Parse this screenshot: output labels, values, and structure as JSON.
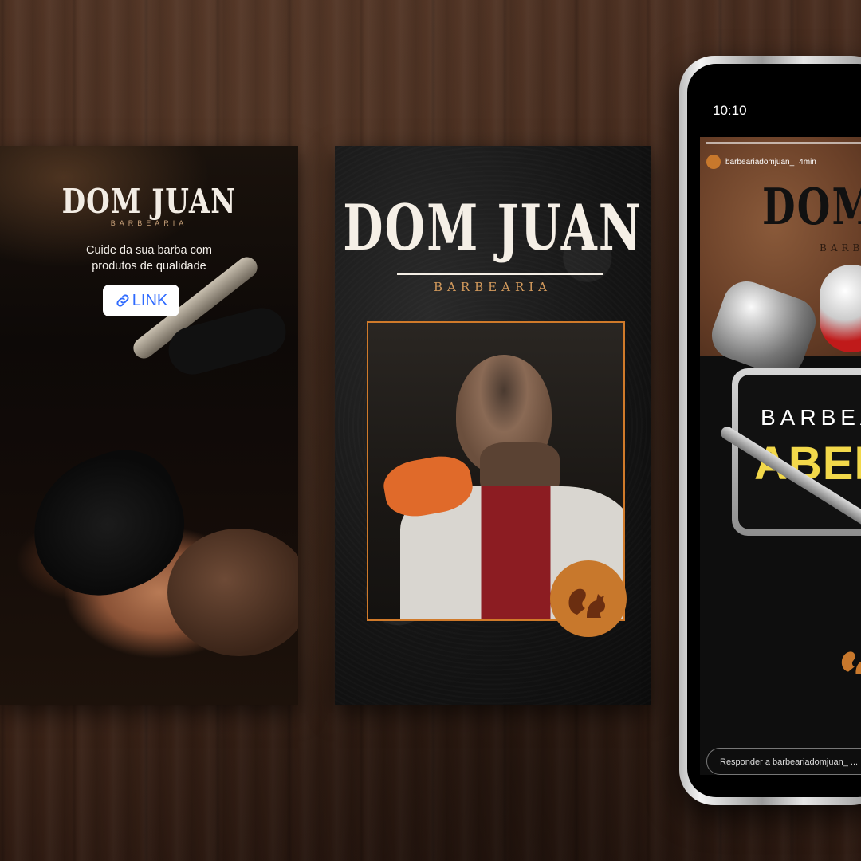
{
  "story_left": {
    "brand_title": "DOM JUAN",
    "brand_sub": "BARBEARIA",
    "tagline_line1": "Cuide da sua barba com",
    "tagline_line2": "produtos de qualidade",
    "link_label": "LINK"
  },
  "story_center": {
    "brand_title": "DOM JUAN",
    "brand_sub": "BARBEARIA"
  },
  "phone": {
    "time": "10:10",
    "username": "barbeariadomjuan_",
    "age": "4min",
    "story_brand_title": "DOM JUAN",
    "story_brand_sub": "BARBEARIA",
    "sign_line1": "BARBEARIA",
    "sign_line2": "ABERTA",
    "reply_placeholder": "Responder a barbeariadomjuan_ ..."
  },
  "colors": {
    "accent_orange": "#c8782c",
    "link_blue": "#2f6bff",
    "sign_yellow": "#f2d84a"
  }
}
